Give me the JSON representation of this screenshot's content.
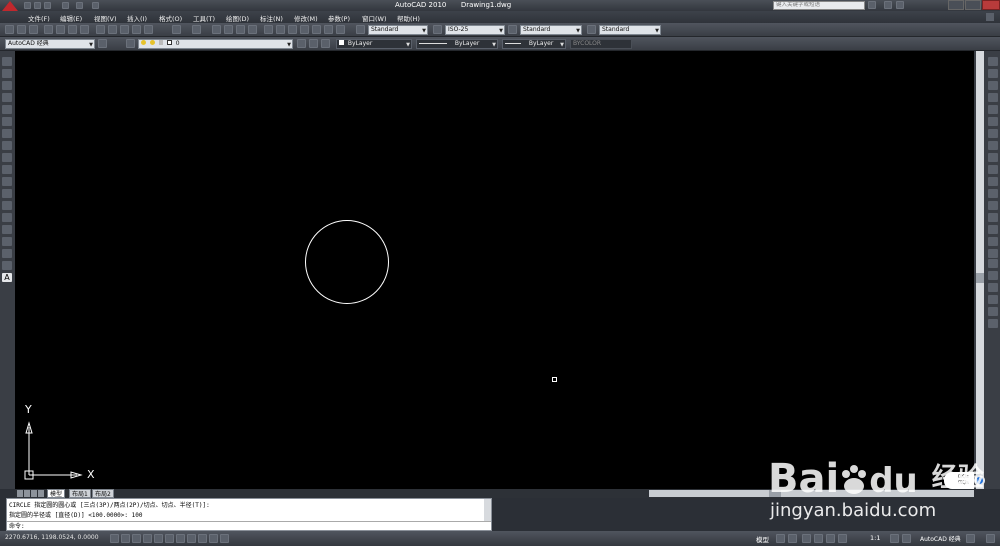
{
  "title_bar": {
    "app": "AutoCAD 2010",
    "file": "Drawing1.dwg",
    "search_placeholder": "键入关键字或短语"
  },
  "menu": [
    "文件(F)",
    "编辑(E)",
    "视图(V)",
    "插入(I)",
    "格式(O)",
    "工具(T)",
    "绘图(D)",
    "标注(N)",
    "修改(M)",
    "参数(P)",
    "窗口(W)",
    "帮助(H)"
  ],
  "toolbar": {
    "workspace": "AutoCAD 经典",
    "layer": "0",
    "text_style": "Standard",
    "dim_style": "ISO-25",
    "table_style": "Standard",
    "mleader_style": "Standard",
    "color": "ByLayer",
    "linetype": "ByLayer",
    "lineweight": "ByLayer",
    "plot_style": "BYCOLOR"
  },
  "ucs": {
    "x_label": "X",
    "y_label": "Y"
  },
  "layout_tabs": [
    "模型",
    "布局1",
    "布局2"
  ],
  "command": {
    "history_line1": "CIRCLE 指定圆的圆心或 [三点(3P)/两点(2P)/切点、切点、半径(T)]:",
    "history_line2": "指定圆的半径或 [直径(D)] <100.0000>: 100",
    "prompt": "命令:"
  },
  "status": {
    "coords": "2270.6716, 1198.0524, 0.0000",
    "model_label": "模型",
    "scale": "1:1",
    "workspace": "AutoCAD 经典"
  },
  "tray": {
    "up_speed": "0K/s",
    "down_speed": "0K/s"
  },
  "watermark": {
    "brand": "Bai",
    "brand2": "du",
    "cn": "经验",
    "url": "jingyan.baidu.com"
  },
  "colors": {
    "canvas": "#000000",
    "accent": "#c0282d",
    "chrome": "#3a3e45"
  }
}
